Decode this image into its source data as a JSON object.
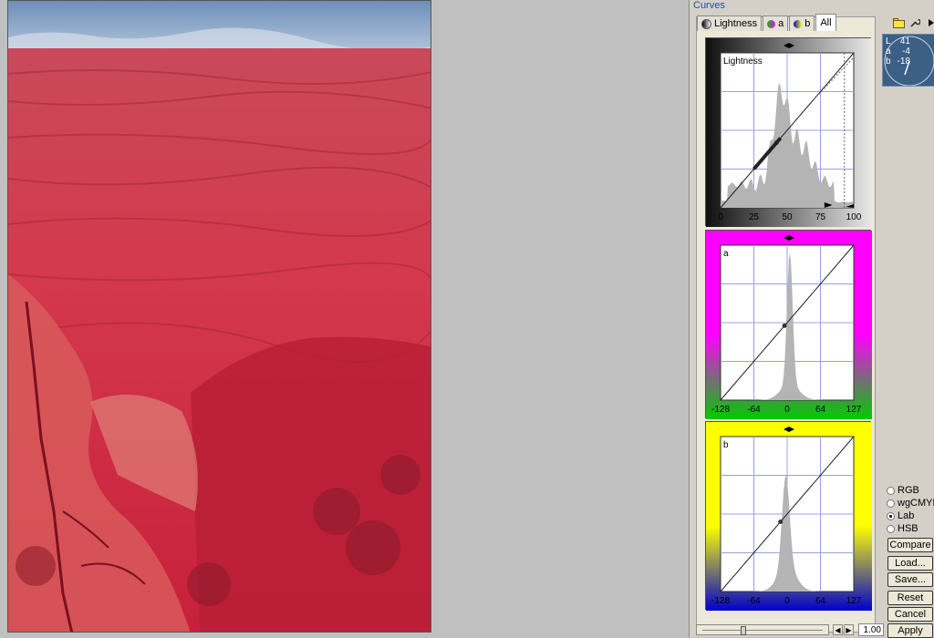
{
  "window": {
    "title": "Curves"
  },
  "tabs": [
    {
      "label": "Lightness",
      "icon": "lightness-icon",
      "active": false
    },
    {
      "label": "a",
      "icon": "a-channel-icon",
      "active": false
    },
    {
      "label": "b",
      "icon": "b-channel-icon",
      "active": false
    },
    {
      "label": "All",
      "icon": "",
      "active": true
    }
  ],
  "graphs": {
    "lightness": {
      "label": "Lightness",
      "ticks": [
        "0",
        "25",
        "50",
        "75",
        "100"
      ]
    },
    "a": {
      "label": "a",
      "ticks": [
        "-128",
        "-64",
        "0",
        "64",
        "127"
      ]
    },
    "b": {
      "label": "b",
      "ticks": [
        "-128",
        "-64",
        "0",
        "64",
        "127"
      ]
    }
  },
  "readout": {
    "rows": [
      {
        "key": "L",
        "value": "41"
      },
      {
        "key": "a",
        "value": "-4"
      },
      {
        "key": "b",
        "value": "-18"
      }
    ]
  },
  "color_modes": [
    {
      "label": "RGB",
      "selected": false
    },
    {
      "label": "wgCMYK",
      "selected": false
    },
    {
      "label": "Lab",
      "selected": true
    },
    {
      "label": "HSB",
      "selected": false
    }
  ],
  "buttons": {
    "compare": "Compare",
    "load": "Load...",
    "save": "Save...",
    "reset": "Reset",
    "cancel": "Cancel",
    "apply": "Apply"
  },
  "zoom": {
    "value": "1.00"
  },
  "colors": {
    "panel_bg": "#d4d0c8",
    "a_top": "#ff00ff",
    "a_bottom": "#00cc00",
    "b_top": "#ffff00",
    "b_bottom": "#0000cc",
    "readout_bg": "#3b5f85",
    "photo_tint": "#d8203c"
  }
}
